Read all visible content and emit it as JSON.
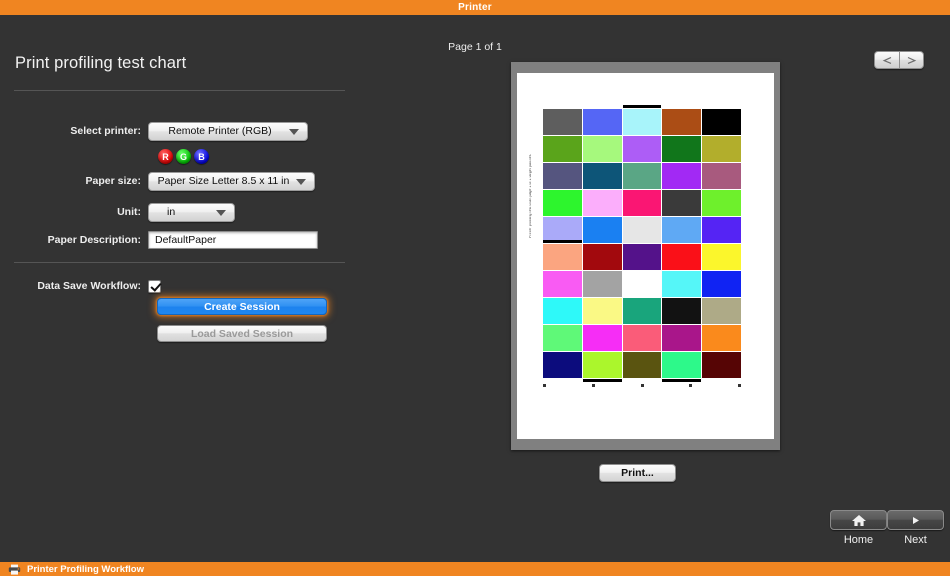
{
  "window": {
    "title": "Printer"
  },
  "left_panel": {
    "page_title": "Print profiling test chart",
    "fields": {
      "printer_label": "Select printer:",
      "printer_value": "Remote Printer (RGB)",
      "channels": [
        "R",
        "G",
        "B"
      ],
      "paper_size_label": "Paper size:",
      "paper_size_value": "Paper Size Letter  8.5 x 11 in",
      "unit_label": "Unit:",
      "unit_value": "in",
      "paper_desc_label": "Paper Description:",
      "paper_desc_value": "DefaultPaper",
      "data_save_label": "Data Save Workflow:"
    },
    "buttons": {
      "create_session": "Create Session",
      "load_saved_session": "Load Saved Session"
    }
  },
  "preview": {
    "page_label": "Page 1 of 1",
    "print_button": "Print...",
    "caption": "Printer profiling test chart page 1 of 1 target patches"
  },
  "bottom_nav": {
    "home_label": "Home",
    "next_label": "Next"
  },
  "status_bar": {
    "text": "Printer Profiling Workflow"
  },
  "colors": {
    "accent_orange": "#f08521",
    "background": "#333333",
    "primary_button": "#2f90f2"
  },
  "chart_data": {
    "type": "table",
    "title": "Print profiling test chart",
    "rows": 10,
    "columns": 5,
    "swatches": [
      [
        "#5e5e5e",
        "#5566f5",
        "#a8f4fa",
        "#ab4d15",
        "#000000"
      ],
      [
        "#5aa41b",
        "#a6f97d",
        "#ad5df6",
        "#11761b",
        "#b2ae2c"
      ],
      [
        "#55557f",
        "#0d5578",
        "#5aa685",
        "#a229f4",
        "#a85a7e"
      ],
      [
        "#2df52d",
        "#fbaefb",
        "#fa1673",
        "#3a3a3a",
        "#6ef02c"
      ],
      [
        "#aaaaf9",
        "#1a80f2",
        "#e6e6e6",
        "#5fa9f4",
        "#5524f4"
      ],
      [
        "#fba580",
        "#a2090d",
        "#54128a",
        "#fa1018",
        "#fbf62c"
      ],
      [
        "#f95bf3",
        "#a3a3a3",
        "#ffffff",
        "#55f6f8",
        "#1023f3"
      ],
      [
        "#2ef9f9",
        "#faf985",
        "#19a57c",
        "#121212",
        "#aeaa87"
      ],
      [
        "#5ff978",
        "#f62df6",
        "#fa5c79",
        "#a9168a",
        "#fa8a1c"
      ],
      [
        "#0c0c7d",
        "#abf62c",
        "#5a5410",
        "#2df98a",
        "#560505"
      ]
    ]
  }
}
